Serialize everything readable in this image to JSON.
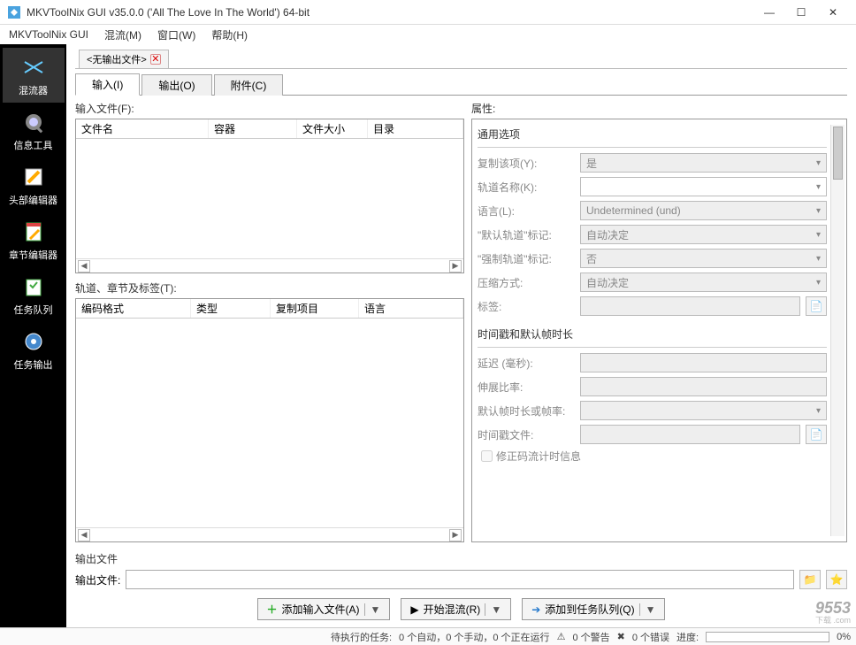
{
  "window": {
    "title": "MKVToolNix GUI v35.0.0 ('All The Love In The World') 64-bit"
  },
  "menu": {
    "gui": "MKVToolNix GUI",
    "mux": "混流(M)",
    "window": "窗口(W)",
    "help": "帮助(H)"
  },
  "sidebar": {
    "items": [
      {
        "label": "混流器"
      },
      {
        "label": "信息工具"
      },
      {
        "label": "头部编辑器"
      },
      {
        "label": "章节编辑器"
      },
      {
        "label": "任务队列"
      },
      {
        "label": "任务输出"
      }
    ]
  },
  "filetab": {
    "label": "<无输出文件>"
  },
  "subtabs": {
    "input": "输入(I)",
    "output": "输出(O)",
    "attach": "附件(C)"
  },
  "left": {
    "inputFilesLabel": "输入文件(F):",
    "cols": {
      "name": "文件名",
      "container": "容器",
      "size": "文件大小",
      "dir": "目录"
    },
    "tracksLabel": "轨道、章节及标签(T):",
    "tcols": {
      "codec": "编码格式",
      "type": "类型",
      "copy": "复制项目",
      "lang": "语言"
    }
  },
  "right": {
    "propsLabel": "属性:",
    "group1": "通用选项",
    "copyItem": {
      "label": "复制该项(Y):",
      "value": "是"
    },
    "trackName": {
      "label": "轨道名称(K):",
      "value": ""
    },
    "language": {
      "label": "语言(L):",
      "value": "Undetermined (und)"
    },
    "defaultFlag": {
      "label": "\"默认轨道\"标记:",
      "value": "自动决定"
    },
    "forcedFlag": {
      "label": "\"强制轨道\"标记:",
      "value": "否"
    },
    "compression": {
      "label": "压缩方式:",
      "value": "自动决定"
    },
    "tags": {
      "label": "标签:",
      "value": ""
    },
    "group2": "时间戳和默认帧时长",
    "delay": {
      "label": "延迟 (毫秒):"
    },
    "stretch": {
      "label": "伸展比率:"
    },
    "defaultDuration": {
      "label": "默认帧时长或帧率:"
    },
    "timestampFile": {
      "label": "时间戳文件:"
    },
    "fixBitstream": "修正码流计时信息"
  },
  "output": {
    "sectionLabel": "输出文件",
    "fieldLabel": "输出文件:"
  },
  "buttons": {
    "addInput": "添加输入文件(A)",
    "startMux": "开始混流(R)",
    "addQueue": "添加到任务队列(Q)"
  },
  "status": {
    "pending": "待执行的任务:",
    "autos": "0 个自动，0 个手动，0 个正在运行",
    "warnings": "0 个警告",
    "errors": "0 个错误",
    "progressLabel": "进度:",
    "progressPct": "0%"
  },
  "watermark": {
    "main": "9553",
    "sub": "下载\n.com"
  }
}
